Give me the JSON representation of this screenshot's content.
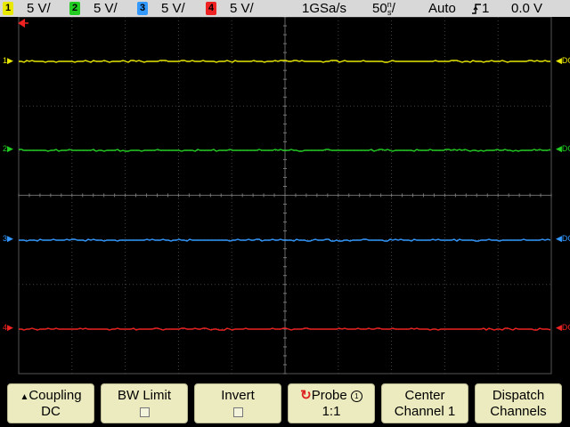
{
  "status_bar": {
    "channels": [
      {
        "number": "1",
        "scale": "5 V/",
        "color": "#e8e800"
      },
      {
        "number": "2",
        "scale": "5 V/",
        "color": "#22cc22"
      },
      {
        "number": "3",
        "scale": "5 V/",
        "color": "#3399ff"
      },
      {
        "number": "4",
        "scale": "5 V/",
        "color": "#ee2222"
      }
    ],
    "sample_rate": "1GSa/s",
    "timebase_value": "50",
    "timebase_unit_top": "n",
    "timebase_unit_bottom": "s",
    "timebase_suffix": "/",
    "trigger_mode": "Auto",
    "trigger_icon": "rising-edge-trigger-icon",
    "trigger_source": "1",
    "trigger_level": "0.0 V"
  },
  "screen": {
    "trigger_marker_icon": "trigger-position-arrow-icon",
    "traces": [
      {
        "label": "1",
        "coupling": "DC",
        "color": "#e8e800"
      },
      {
        "label": "2",
        "coupling": "DC",
        "color": "#22cc22"
      },
      {
        "label": "3",
        "coupling": "DC",
        "color": "#3399ff"
      },
      {
        "label": "4",
        "coupling": "DC",
        "color": "#ee2222"
      }
    ]
  },
  "softkeys": [
    {
      "line1": "Coupling",
      "line2": "DC",
      "icon": "up-triangle-icon"
    },
    {
      "line1": "BW Limit",
      "line2": ""
    },
    {
      "line1": "Invert",
      "line2": ""
    },
    {
      "line1": "Probe",
      "line2": "1:1",
      "icon": "rotate-knob-icon",
      "badge": "1"
    },
    {
      "line1": "Center",
      "line2": "Channel 1"
    },
    {
      "line1": "Dispatch",
      "line2": "Channels"
    }
  ]
}
